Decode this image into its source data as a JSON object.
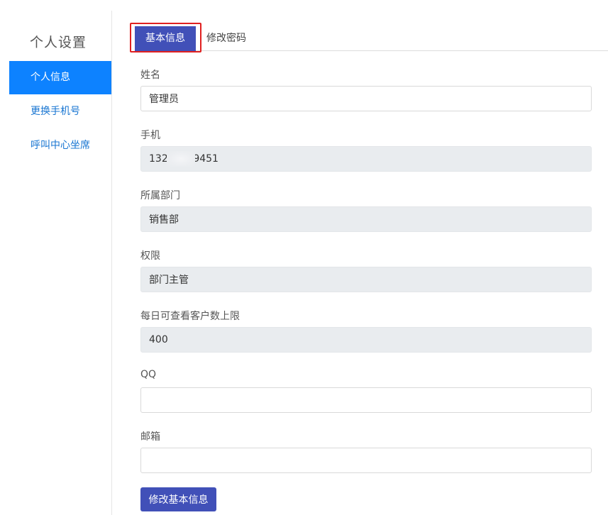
{
  "sidebar": {
    "title": "个人设置",
    "items": [
      {
        "label": "个人信息",
        "active": true
      },
      {
        "label": "更换手机号",
        "active": false
      },
      {
        "label": "呼叫中心坐席",
        "active": false
      }
    ]
  },
  "tabs": {
    "basic_info": "基本信息",
    "change_password": "修改密码"
  },
  "form": {
    "name": {
      "label": "姓名",
      "value": "管理员"
    },
    "phone": {
      "label": "手机",
      "value": "132        9451"
    },
    "department": {
      "label": "所属部门",
      "value": "销售部"
    },
    "role": {
      "label": "权限",
      "value": "部门主管"
    },
    "daily_limit": {
      "label": "每日可查看客户数上限",
      "value": "400"
    },
    "qq": {
      "label": "QQ",
      "value": ""
    },
    "email": {
      "label": "邮箱",
      "value": ""
    },
    "submit_label": "修改基本信息"
  },
  "colors": {
    "primary": "#4150b8",
    "sidebar_active": "#0d82ff",
    "link": "#1976d2",
    "highlight_border": "#e02020",
    "readonly_bg": "#e9ecef"
  }
}
